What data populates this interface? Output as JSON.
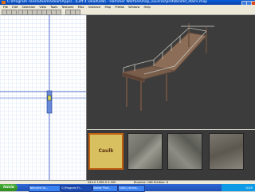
{
  "window": {
    "title": "C:\\Program Files\\Steam\\SteamApps\\...\\Left 4 Dead\\sdk\\ - Hammer Warfare\\map_sources\\prefabs\\l4d_stairs.map"
  },
  "menu": [
    "File",
    "Edit",
    "Selection",
    "View",
    "Tools",
    "Textures",
    "Misc",
    "Instance",
    "Map",
    "Prefab",
    "Window",
    "Help"
  ],
  "textures": {
    "caulk_label": "Caulk"
  },
  "status": {
    "coords": "544.0    1456.0    0.000",
    "brushes": "Brushes: 186 Entities: 6"
  },
  "taskbar": {
    "start": "Inicio",
    "tasks": [
      "Welcome to...",
      "C:\\Program Fi...",
      "Adobe Phot...",
      "Colón_recons..."
    ],
    "clock": "0:05"
  },
  "colors": {
    "accent": "#0a5fd8",
    "grid_line": "#bcd0f0",
    "caulk": "#d8c060"
  },
  "icons": [
    "app-icon",
    "minimize-icon",
    "maximize-icon",
    "close-icon"
  ]
}
